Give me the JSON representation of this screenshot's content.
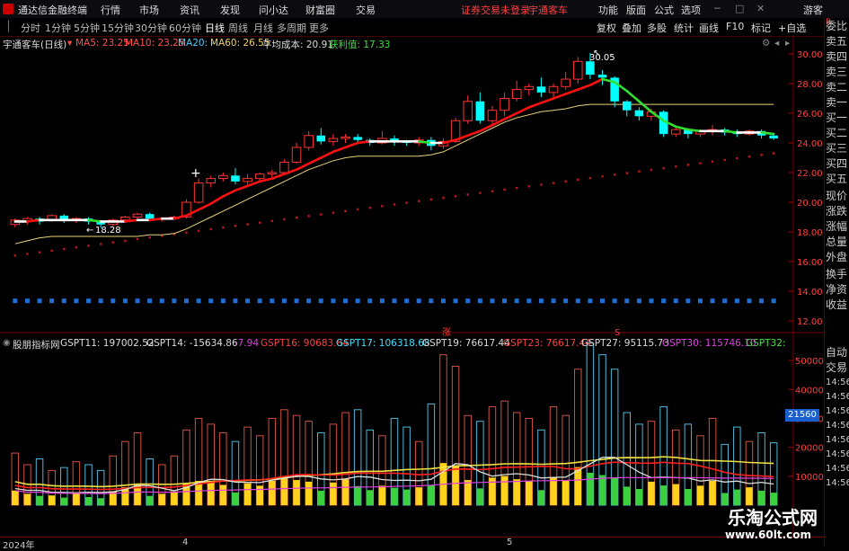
{
  "app": {
    "title": "通达信金融终端",
    "menu": [
      "行情",
      "市场",
      "资讯",
      "发现",
      "问小达",
      "财富圈",
      "交易"
    ],
    "notice": "证券交易未登录",
    "stock_name_red": "宇通客车",
    "right_menu": [
      "功能",
      "版面",
      "公式",
      "选项"
    ],
    "guest": "游客"
  },
  "periods": [
    "分时",
    "1分钟",
    "5分钟",
    "15分钟",
    "30分钟",
    "60分钟",
    "日线",
    "周线",
    "月线",
    "多周期",
    "更多"
  ],
  "active_period": "日线",
  "tools": [
    "复权",
    "叠加",
    "多股",
    "统计",
    "画线",
    "F10",
    "标记",
    "+自选"
  ],
  "main": {
    "stock_label": "宇通客车(日线)",
    "ma5": "MA5: 23.25",
    "ma10": "MA10: 23.25",
    "ma20": "MA20: -",
    "ma60": "MA60: 26.55",
    "avgcost": "平均成本: 20.91",
    "profit": "获利值: 17.33",
    "price_ticks": [
      "30.00",
      "28.00",
      "26.00",
      "24.00",
      "22.00",
      "20.00",
      "18.00",
      "16.00",
      "14.00",
      "12.00"
    ],
    "high_label": "30.05",
    "low_label": "18.28"
  },
  "sub": {
    "indicator_name": "股朋指标网",
    "gspt11": "GSPT11: 197002.52",
    "gspt14": "GSPT14: -15634.86",
    "gspt_neg": ": -7.94",
    "gspt16": "GSPT16: 90683.84",
    "gspt17": "GSPT17: 106318.68",
    "gspt19": "GSPT19: 76617.44",
    "gspt23": "GSPT23: 76617.44",
    "gspt27": "GSPT27: 95115.73",
    "gspt30": "GSPT30: 115746.10",
    "gspt32": "GSPT32:",
    "vol_ticks": [
      "50000",
      "40000",
      "30000",
      "20000",
      "10000"
    ],
    "current_value": "21560",
    "marker_up": "涨",
    "marker_s": "S"
  },
  "xaxis": [
    "2024年",
    "4",
    "5"
  ],
  "rightpanel": [
    "委比",
    "卖五",
    "卖四",
    "卖三",
    "卖二",
    "卖一",
    "买一",
    "买二",
    "买三",
    "买四",
    "买五",
    "现价",
    "涨跌",
    "涨幅",
    "总量",
    "外盘",
    "换手",
    "净资",
    "收益"
  ],
  "rightpanel_lower": [
    "自动",
    "交易",
    "14:56",
    "14:56",
    "14:56",
    "14:56",
    "14:56",
    "14:56",
    "14:56",
    "14:56"
  ],
  "rightpanel_top": "R",
  "watermark": {
    "title": "乐淘公式网",
    "url": "www.60lt.com"
  },
  "colors": {
    "up": "#ff3232",
    "down": "#00ffff",
    "ma_red": "#ff1010",
    "ma_green": "#30e030",
    "avg": "#e8d27a",
    "dots": "#c01818",
    "blue_dots": "#1e6fd6"
  },
  "chart_data": {
    "type": "candlestick",
    "price_range": [
      12,
      30.5
    ],
    "candles": [
      [
        18.5,
        18.8,
        18.9,
        18.3
      ],
      [
        18.7,
        18.9,
        19.0,
        18.5
      ],
      [
        18.9,
        18.7,
        19.0,
        18.5
      ],
      [
        18.8,
        19.1,
        19.2,
        18.7
      ],
      [
        19.1,
        18.8,
        19.2,
        18.6
      ],
      [
        18.8,
        18.9,
        19.0,
        18.6
      ],
      [
        18.9,
        18.7,
        19.0,
        18.5
      ],
      [
        18.7,
        18.5,
        18.8,
        18.28
      ],
      [
        18.5,
        18.8,
        18.9,
        18.4
      ],
      [
        18.8,
        19.0,
        19.1,
        18.7
      ],
      [
        19.0,
        19.2,
        19.3,
        18.9
      ],
      [
        19.2,
        18.9,
        19.3,
        18.8
      ],
      [
        18.9,
        18.9,
        19.0,
        18.7
      ],
      [
        18.9,
        19.0,
        19.1,
        18.8
      ],
      [
        19.0,
        20.0,
        20.2,
        18.9
      ],
      [
        20.0,
        21.3,
        21.6,
        19.9
      ],
      [
        21.3,
        21.6,
        21.8,
        21.0
      ],
      [
        21.6,
        21.8,
        22.0,
        21.4
      ],
      [
        21.8,
        21.4,
        22.3,
        21.2
      ],
      [
        21.4,
        21.6,
        21.9,
        21.2
      ],
      [
        21.6,
        21.9,
        22.0,
        21.4
      ],
      [
        21.9,
        22.0,
        22.2,
        21.7
      ],
      [
        22.0,
        22.7,
        22.9,
        21.9
      ],
      [
        22.7,
        23.7,
        24.0,
        22.6
      ],
      [
        23.7,
        24.5,
        24.8,
        23.5
      ],
      [
        24.5,
        24.1,
        25.0,
        23.9
      ],
      [
        24.1,
        24.3,
        24.6,
        23.8
      ],
      [
        24.3,
        24.4,
        24.6,
        24.0
      ],
      [
        24.4,
        24.2,
        24.6,
        23.9
      ],
      [
        24.2,
        24.0,
        24.3,
        23.8
      ],
      [
        24.0,
        24.3,
        24.8,
        23.9
      ],
      [
        24.3,
        24.1,
        24.5,
        23.8
      ],
      [
        24.1,
        24.0,
        24.2,
        23.8
      ],
      [
        24.0,
        24.2,
        24.4,
        23.8
      ],
      [
        24.2,
        23.8,
        24.4,
        23.5
      ],
      [
        23.8,
        24.1,
        24.3,
        23.6
      ],
      [
        24.1,
        25.5,
        25.7,
        24.0
      ],
      [
        25.5,
        26.8,
        27.2,
        25.3
      ],
      [
        26.8,
        25.5,
        27.4,
        25.3
      ],
      [
        25.5,
        26.2,
        26.5,
        25.2
      ],
      [
        26.2,
        27.0,
        27.4,
        25.8
      ],
      [
        27.0,
        27.6,
        28.2,
        26.8
      ],
      [
        27.6,
        27.8,
        28.0,
        27.2
      ],
      [
        27.8,
        27.4,
        28.4,
        27.1
      ],
      [
        27.4,
        27.8,
        28.0,
        27.0
      ],
      [
        27.8,
        28.3,
        28.8,
        27.6
      ],
      [
        28.3,
        29.5,
        29.8,
        28.0
      ],
      [
        29.5,
        28.6,
        30.05,
        28.3
      ],
      [
        28.6,
        28.4,
        28.9,
        27.9
      ],
      [
        28.4,
        26.8,
        28.5,
        26.4
      ],
      [
        26.8,
        26.2,
        26.9,
        25.8
      ],
      [
        26.2,
        25.8,
        26.4,
        25.5
      ],
      [
        25.8,
        26.1,
        26.3,
        25.5
      ],
      [
        26.1,
        24.6,
        26.2,
        24.4
      ],
      [
        24.6,
        24.9,
        25.1,
        24.4
      ],
      [
        24.9,
        24.6,
        25.0,
        24.3
      ],
      [
        24.6,
        24.8,
        24.9,
        24.4
      ],
      [
        24.8,
        24.9,
        25.2,
        24.5
      ],
      [
        24.9,
        24.7,
        25.0,
        24.5
      ],
      [
        24.7,
        24.6,
        24.9,
        24.4
      ],
      [
        24.6,
        24.8,
        24.9,
        24.5
      ],
      [
        24.8,
        24.5,
        24.9,
        24.3
      ],
      [
        24.5,
        24.3,
        24.6,
        24.2
      ]
    ],
    "ma_line": [
      18.7,
      18.7,
      18.8,
      18.8,
      18.8,
      18.8,
      18.8,
      18.7,
      18.7,
      18.7,
      18.8,
      18.8,
      18.9,
      18.9,
      19.1,
      19.5,
      19.9,
      20.4,
      20.8,
      21.1,
      21.4,
      21.6,
      21.9,
      22.2,
      22.6,
      23.0,
      23.4,
      23.7,
      24.0,
      24.1,
      24.1,
      24.1,
      24.1,
      24.1,
      24.0,
      24.0,
      24.2,
      24.5,
      24.8,
      25.2,
      25.6,
      26.0,
      26.4,
      26.7,
      27.0,
      27.3,
      27.6,
      27.9,
      28.3,
      28.1,
      27.5,
      26.8,
      26.1,
      25.5,
      25.1,
      24.9,
      24.8,
      24.8,
      24.8,
      24.7,
      24.7,
      24.7,
      24.6
    ],
    "avg_line": [
      17.2,
      17.4,
      17.6,
      17.7,
      17.7,
      17.7,
      17.7,
      17.7,
      17.7,
      17.7,
      17.7,
      17.8,
      17.8,
      17.9,
      18.2,
      18.6,
      19.0,
      19.4,
      19.8,
      20.2,
      20.6,
      21.0,
      21.4,
      21.8,
      22.2,
      22.5,
      22.8,
      23.0,
      23.1,
      23.1,
      23.1,
      23.1,
      23.1,
      23.1,
      23.2,
      23.4,
      23.8,
      24.2,
      24.6,
      25.0,
      25.4,
      25.7,
      25.9,
      26.1,
      26.2,
      26.3,
      26.5,
      26.6,
      26.6,
      26.6,
      26.6,
      26.6,
      26.6,
      26.6,
      26.6,
      26.6,
      26.6,
      26.6,
      26.6,
      26.6,
      26.6,
      26.6,
      26.6
    ],
    "volume": [
      18000,
      14000,
      16000,
      12000,
      13000,
      15000,
      14000,
      12000,
      17000,
      22000,
      25000,
      16000,
      14000,
      17000,
      26000,
      30000,
      28000,
      25000,
      22000,
      27000,
      24000,
      30000,
      33000,
      31000,
      29000,
      25000,
      28000,
      32000,
      33000,
      26000,
      24000,
      30000,
      27000,
      22000,
      35000,
      52000,
      48000,
      31000,
      29000,
      34000,
      36000,
      32000,
      30000,
      26000,
      34000,
      31000,
      47000,
      56000,
      52000,
      47000,
      32000,
      28000,
      29000,
      34000,
      26000,
      28000,
      24000,
      30000,
      21000,
      27000,
      22000,
      25000,
      21560
    ]
  }
}
